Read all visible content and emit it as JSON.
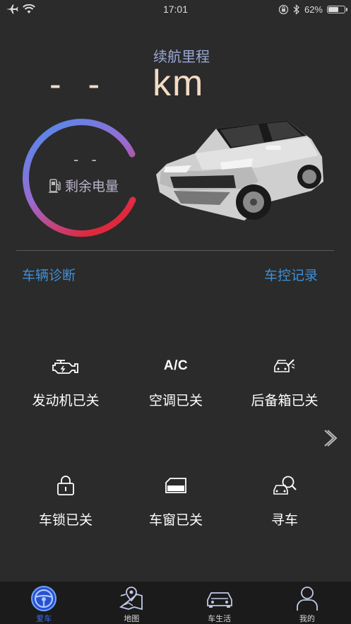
{
  "status_bar": {
    "time": "17:01",
    "battery": "62%",
    "battery_level": 0.62,
    "icons": [
      "airplane-icon",
      "wifi-icon",
      "rotation-lock-icon",
      "bluetooth-icon",
      "battery-icon"
    ]
  },
  "range": {
    "label": "续航里程",
    "value": "- -",
    "unit": "km"
  },
  "gauge": {
    "value": "- -",
    "label": "剩余电量",
    "colors": {
      "start": "#4a8ff0",
      "mid": "#9b6ad0",
      "end": "#e0283c"
    }
  },
  "links": {
    "diagnosis": "车辆诊断",
    "control_records": "车控记录"
  },
  "status_tiles": [
    {
      "icon": "engine-icon",
      "label": "发动机已关"
    },
    {
      "icon": "A/C",
      "label": "空调已关"
    },
    {
      "icon": "trunk-icon",
      "label": "后备箱已关"
    },
    {
      "icon": "lock-icon",
      "label": "车锁已关"
    },
    {
      "icon": "window-icon",
      "label": "车窗已关"
    },
    {
      "icon": "find-car-icon",
      "label": "寻车"
    }
  ],
  "tabs": [
    {
      "label": "爱车",
      "icon": "steering-wheel-icon",
      "active": true
    },
    {
      "label": "地图",
      "icon": "map-icon",
      "active": false
    },
    {
      "label": "车生活",
      "icon": "car-icon",
      "active": false
    },
    {
      "label": "我的",
      "icon": "person-icon",
      "active": false
    }
  ],
  "colors": {
    "background": "#2b2b2b",
    "accent": "#3f8fd8",
    "range_text": "#f2dcc4",
    "tab_active": "#3b6ff0"
  }
}
